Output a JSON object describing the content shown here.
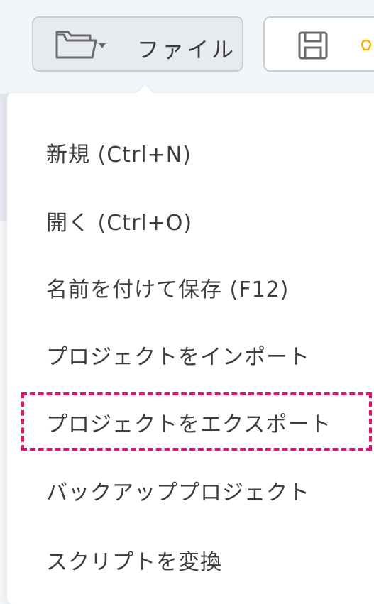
{
  "toolbar": {
    "file_label": "ファイル",
    "folder_icon": "folder-dropdown-icon",
    "save_icon": "save-icon",
    "partial_icon_color": "#f2b200"
  },
  "menu": {
    "items": [
      {
        "label": "新規 (Ctrl+N)"
      },
      {
        "label": "開く (Ctrl+O)"
      },
      {
        "label": "名前を付けて保存 (F12)"
      },
      {
        "label": "プロジェクトをインポート"
      },
      {
        "label": "プロジェクトをエクスポート",
        "highlighted": true
      },
      {
        "label": "バックアッププロジェクト"
      },
      {
        "label": "スクリプトを変換"
      }
    ]
  },
  "colors": {
    "highlight": "#e0136f",
    "background": "#f3f6f9",
    "menu_background": "#ffffff"
  }
}
